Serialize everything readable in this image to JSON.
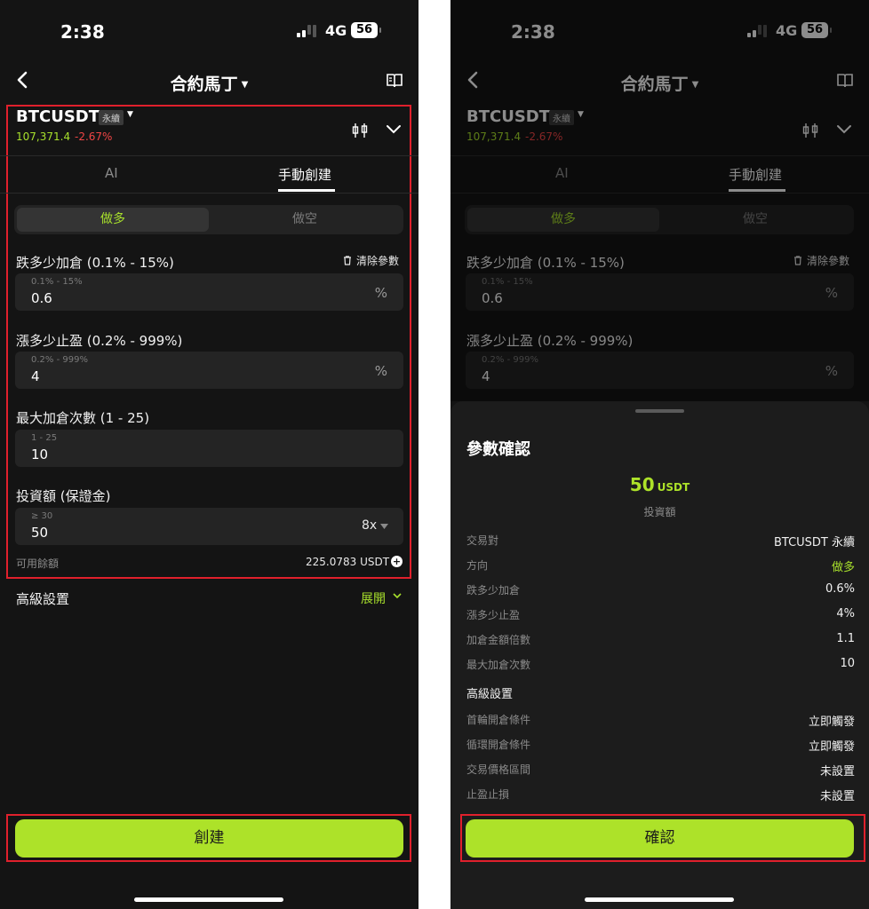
{
  "status": {
    "time": "2:38",
    "network": "4G",
    "battery": "56"
  },
  "header": {
    "title": "合約馬丁"
  },
  "symbol": {
    "name": "BTCUSDT",
    "type": "永續",
    "price": "107,371.4",
    "change": "-2.67%"
  },
  "tabs": {
    "ai": "AI",
    "manual": "手動創建"
  },
  "direction": {
    "long": "做多",
    "short": "做空"
  },
  "form": {
    "drop_label": "跌多少加倉 (0.1% - 15%)",
    "clear": "清除參數",
    "drop_placeholder": "0.1% - 15%",
    "drop_value": "0.6",
    "pct_unit": "%",
    "rise_label": "漲多少止盈 (0.2% - 999%)",
    "rise_placeholder": "0.2% - 999%",
    "rise_value": "4",
    "max_label": "最大加倉次數 (1 - 25)",
    "max_placeholder": "1 - 25",
    "max_value": "10",
    "invest_label": "投資額 (保證金)",
    "invest_placeholder": "≥ 30",
    "invest_value": "50",
    "leverage": "8x",
    "available_label": "可用餘額",
    "available_value": "225.0783 USDT"
  },
  "advanced": {
    "label": "高級設置",
    "expand": "展開"
  },
  "buttons": {
    "create": "創建",
    "confirm": "確認"
  },
  "confirm_sheet": {
    "title": "參數確認",
    "amount": "50",
    "amount_unit": "USDT",
    "amount_label": "投資額",
    "rows": [
      {
        "label": "交易對",
        "value": "BTCUSDT 永續"
      },
      {
        "label": "方向",
        "value": "做多"
      },
      {
        "label": "跌多少加倉",
        "value": "0.6%"
      },
      {
        "label": "漲多少止盈",
        "value": "4%"
      },
      {
        "label": "加倉金額倍數",
        "value": "1.1"
      },
      {
        "label": "最大加倉次數",
        "value": "10"
      }
    ],
    "advanced_title": "高級設置",
    "advanced_rows": [
      {
        "label": "首輪開倉條件",
        "value": "立即觸發"
      },
      {
        "label": "循環開倉條件",
        "value": "立即觸發"
      },
      {
        "label": "交易價格區間",
        "value": "未設置"
      },
      {
        "label": "止盈止損",
        "value": "未設置"
      }
    ]
  },
  "colors": {
    "accent": "#ade229",
    "price_up": "#a8e02c",
    "price_down": "#f04545",
    "highlight": "#e0202c"
  }
}
